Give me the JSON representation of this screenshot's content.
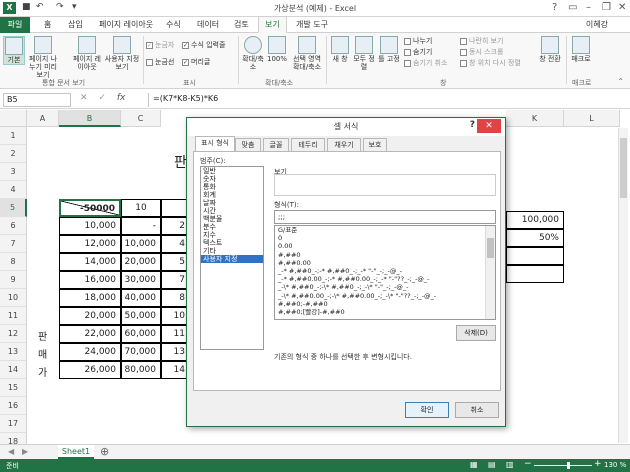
{
  "app": {
    "title": "가상분석 (예제) - Excel",
    "user": "이혜강",
    "icon_letter": "X"
  },
  "ribbon_tabs": [
    "파일",
    "홈",
    "삽입",
    "페이지 레이아웃",
    "수식",
    "데이터",
    "검토",
    "보기",
    "개발 도구"
  ],
  "ribbon": {
    "views": [
      "기본",
      "페이지 나누기 미리 보기",
      "페이지 레이아웃",
      "사용자 지정 보기"
    ],
    "views_group": "통합 문서 보기",
    "show_items": [
      {
        "label": "눈금자",
        "checked": true,
        "disabled": true
      },
      {
        "label": "수식 입력줄",
        "checked": true,
        "disabled": false
      },
      {
        "label": "눈금선",
        "checked": false,
        "disabled": false
      },
      {
        "label": "머리글",
        "checked": true,
        "disabled": false
      }
    ],
    "show_group": "표시",
    "zoom_buttons": [
      "확대/축소",
      "100%",
      "선택 영역 확대/축소"
    ],
    "zoom_group": "확대/축소",
    "window_buttons": [
      "새 창",
      "모두 정렬",
      "틀 고정"
    ],
    "window_small": [
      {
        "label": "나누기",
        "disabled": false
      },
      {
        "label": "숨기기",
        "disabled": false
      },
      {
        "label": "숨기기 취소",
        "disabled": true
      },
      {
        "label": "나란히 보기",
        "disabled": true
      },
      {
        "label": "동시 스크롤",
        "disabled": true
      },
      {
        "label": "창 위치 다시 정렬",
        "disabled": true
      }
    ],
    "switch_window": "창 전환",
    "window_group": "창",
    "macro_button": "매크로",
    "macro_group": "매크로"
  },
  "formula_bar": {
    "name_box": "B5",
    "fx": "fx",
    "formula": "=(K7*K8-K5)*K6"
  },
  "sheet": {
    "columns": [
      "A",
      "B",
      "C",
      "K",
      "L"
    ],
    "rows": [
      "1",
      "2",
      "3",
      "4",
      "5",
      "6",
      "7",
      "8",
      "9",
      "10",
      "11",
      "12",
      "13",
      "14",
      "15",
      "16",
      "17",
      "18"
    ],
    "col_b": [
      "-50000",
      "10,000",
      "12,000",
      "14,000",
      "16,000",
      "18,000",
      "20,000",
      "22,000",
      "24,000",
      "26,000"
    ],
    "col_c": [
      "10",
      "-",
      "10,000",
      "20,000",
      "30,000",
      "40,000",
      "50,000",
      "60,000",
      "70,000",
      "80,000"
    ],
    "col_d_partial": [
      "",
      "2",
      "4",
      "5",
      "7",
      "8",
      "10",
      "11",
      "13",
      "14"
    ],
    "k5": "100,000",
    "k6": "50%",
    "vertical_label": [
      "판",
      "매",
      "가"
    ],
    "title_partial": "판",
    "sheet_tab": "Sheet1"
  },
  "dialog": {
    "title": "셀 서식",
    "help": "?",
    "close": "✕",
    "tabs": [
      "표시 형식",
      "맞춤",
      "글꼴",
      "테두리",
      "채우기",
      "보호"
    ],
    "category_label": "범주(C):",
    "categories": [
      "일반",
      "숫자",
      "통화",
      "회계",
      "날짜",
      "시간",
      "백분율",
      "분수",
      "지수",
      "텍스트",
      "기타",
      "사용자 지정"
    ],
    "selected_category": "사용자 지정",
    "preview_label": "보기",
    "type_label": "형식(T):",
    "type_value": ";;;",
    "formats": [
      "G/표준",
      "0",
      "0.00",
      "#,##0",
      "#,##0.00",
      "_-* #,##0_-;-* #,##0_-;_-* \"-\"_-;_-@_-",
      "_-* #,##0.00_-;-* #,##0.00_-;_-* \"-\"??_-;_-@_-",
      "_-\\* #,##0_-;-\\* #,##0_-;_-\\* \"-\"_-;_-@_-",
      "_-\\* #,##0.00_-;-\\* #,##0.00_-;_-\\* \"-\"??_-;_-@_-",
      "#,##0;-#,##0",
      "#,##0;[빨강]-#,##0"
    ],
    "delete_button": "삭제(D)",
    "note": "기존의 형식 중 하나를 선택한 후 변형시킵니다.",
    "ok": "확인",
    "cancel": "취소"
  },
  "status": {
    "ready": "준비",
    "zoom": "130 %"
  },
  "colors": {
    "accent": "#217346",
    "close": "#e04343",
    "selection": "#3072c8"
  }
}
